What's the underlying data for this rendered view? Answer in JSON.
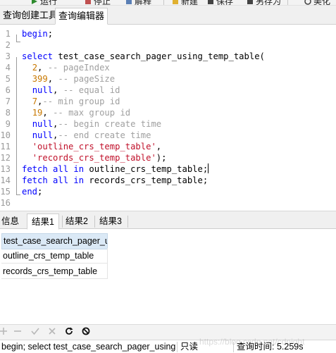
{
  "toolbar": {
    "items": [
      {
        "label": "运行"
      },
      {
        "label": "停止"
      },
      {
        "label": "解释"
      },
      {
        "label": "新建"
      },
      {
        "label": "保存"
      },
      {
        "label": "另存为"
      },
      {
        "label": "美化"
      }
    ]
  },
  "editor_tabs": [
    {
      "label": "查询创建工具",
      "active": false
    },
    {
      "label": "查询编辑器",
      "active": true
    }
  ],
  "code_lines": [
    {
      "n": "1",
      "tokens": [
        {
          "t": "begin",
          "c": "kw"
        },
        {
          "t": ";",
          "c": "pl"
        }
      ]
    },
    {
      "n": "2",
      "tokens": []
    },
    {
      "n": "3",
      "tokens": [
        {
          "t": "select",
          "c": "kw"
        },
        {
          "t": " test_case_search_pager_using_temp_table(",
          "c": "pl"
        }
      ]
    },
    {
      "n": "4",
      "tokens": [
        {
          "t": "  ",
          "c": "pl"
        },
        {
          "t": "2",
          "c": "num"
        },
        {
          "t": ", ",
          "c": "pl"
        },
        {
          "t": "-- pageIndex",
          "c": "cm"
        }
      ]
    },
    {
      "n": "5",
      "tokens": [
        {
          "t": "  ",
          "c": "pl"
        },
        {
          "t": "399",
          "c": "num"
        },
        {
          "t": ", ",
          "c": "pl"
        },
        {
          "t": "-- pageSize",
          "c": "cm"
        }
      ]
    },
    {
      "n": "6",
      "tokens": [
        {
          "t": "  ",
          "c": "pl"
        },
        {
          "t": "null",
          "c": "kw"
        },
        {
          "t": ", ",
          "c": "pl"
        },
        {
          "t": "-- equal id",
          "c": "cm"
        }
      ]
    },
    {
      "n": "7",
      "tokens": [
        {
          "t": "  ",
          "c": "pl"
        },
        {
          "t": "7",
          "c": "num"
        },
        {
          "t": ",",
          "c": "pl"
        },
        {
          "t": "-- min group id",
          "c": "cm"
        }
      ]
    },
    {
      "n": "8",
      "tokens": [
        {
          "t": "  ",
          "c": "pl"
        },
        {
          "t": "19",
          "c": "num"
        },
        {
          "t": ", ",
          "c": "pl"
        },
        {
          "t": "-- max group id",
          "c": "cm"
        }
      ]
    },
    {
      "n": "9",
      "tokens": [
        {
          "t": "  ",
          "c": "pl"
        },
        {
          "t": "null",
          "c": "kw"
        },
        {
          "t": ",",
          "c": "pl"
        },
        {
          "t": "-- begin create time",
          "c": "cm"
        }
      ]
    },
    {
      "n": "10",
      "tokens": [
        {
          "t": "  ",
          "c": "pl"
        },
        {
          "t": "null",
          "c": "kw"
        },
        {
          "t": ",",
          "c": "pl"
        },
        {
          "t": "-- end create time",
          "c": "cm"
        }
      ]
    },
    {
      "n": "11",
      "tokens": [
        {
          "t": "  ",
          "c": "pl"
        },
        {
          "t": "'outline_crs_temp_table'",
          "c": "str"
        },
        {
          "t": ",",
          "c": "pl"
        }
      ]
    },
    {
      "n": "12",
      "tokens": [
        {
          "t": "  ",
          "c": "pl"
        },
        {
          "t": "'records_crs_temp_table'",
          "c": "str"
        },
        {
          "t": ");",
          "c": "pl"
        }
      ]
    },
    {
      "n": "13",
      "tokens": [
        {
          "t": "fetch",
          "c": "kw"
        },
        {
          "t": " ",
          "c": "pl"
        },
        {
          "t": "all",
          "c": "kw"
        },
        {
          "t": " ",
          "c": "pl"
        },
        {
          "t": "in",
          "c": "kw"
        },
        {
          "t": " outline_crs_temp_table;",
          "c": "pl"
        }
      ],
      "caret": true
    },
    {
      "n": "14",
      "tokens": [
        {
          "t": "fetch",
          "c": "kw"
        },
        {
          "t": " ",
          "c": "pl"
        },
        {
          "t": "all",
          "c": "kw"
        },
        {
          "t": " ",
          "c": "pl"
        },
        {
          "t": "in",
          "c": "kw"
        },
        {
          "t": " records_crs_temp_table;",
          "c": "pl"
        }
      ]
    },
    {
      "n": "15",
      "tokens": [
        {
          "t": "end",
          "c": "kw"
        },
        {
          "t": ";",
          "c": "pl"
        }
      ]
    },
    {
      "n": "16",
      "tokens": []
    }
  ],
  "result_tabs": [
    {
      "label": "信息",
      "active": false
    },
    {
      "label": "结果1",
      "active": true
    },
    {
      "label": "结果2",
      "active": false
    },
    {
      "label": "结果3",
      "active": false
    }
  ],
  "result_grid": {
    "columns": [
      "test_case_search_pager_u"
    ],
    "rows": [
      [
        "outline_crs_temp_table"
      ],
      [
        "records_crs_temp_table"
      ]
    ]
  },
  "nav_icons": [
    {
      "name": "add-record-icon",
      "glyph": "+",
      "enabled": false
    },
    {
      "name": "delete-record-icon",
      "glyph": "−",
      "enabled": false
    },
    {
      "name": "apply-icon",
      "glyph": "✓",
      "enabled": false
    },
    {
      "name": "discard-icon",
      "glyph": "✕",
      "enabled": false
    },
    {
      "name": "refresh-icon",
      "glyph": "↻",
      "enabled": true
    },
    {
      "name": "stop-icon",
      "glyph": "⊘",
      "enabled": true
    }
  ],
  "status": {
    "query": "begin;  select test_case_search_pager_using",
    "mode": "只读",
    "time": "查询时间: 5.259s"
  },
  "watermark": "https://blog.csdn.net/cdnight",
  "colors": {
    "keyword": "#0000ff",
    "comment": "#a0a0a0",
    "number": "#c87800",
    "string": "#c0102a",
    "grid_header_bg": "#dbe9f6"
  }
}
